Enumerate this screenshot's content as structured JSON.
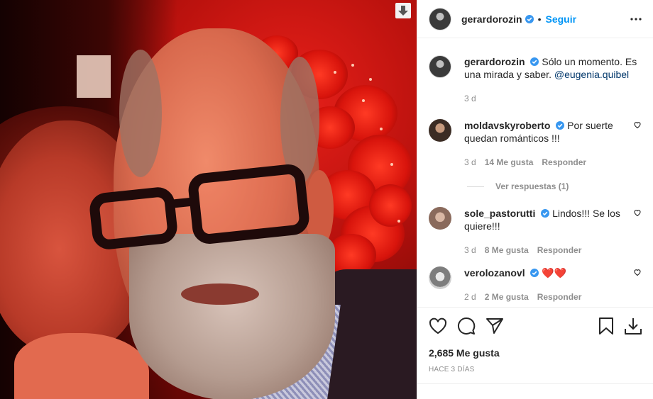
{
  "post": {
    "author": "gerardorozin",
    "follow_label": "Seguir",
    "separator": "•",
    "caption": {
      "author": "gerardorozin",
      "text": "Sólo un momento. Es una mirada y saber.",
      "mention": "@eugenia.quibel",
      "time": "3 d"
    },
    "comments": [
      {
        "user": "moldavskyroberto",
        "text": "Por suerte quedan románticos !!!",
        "time": "3 d",
        "likes": "14 Me gusta",
        "reply": "Responder",
        "avatar": "moldavsky"
      },
      {
        "user": "sole_pastorutti",
        "text": "Lindos!!! Se los quiere!!!",
        "time": "3 d",
        "likes": "8 Me gusta",
        "reply": "Responder",
        "avatar": "sole"
      },
      {
        "user": "verolozanovl",
        "text": "❤️❤️",
        "time": "2 d",
        "likes": "2 Me gusta",
        "reply": "Responder",
        "avatar": "vero"
      }
    ],
    "view_replies": "Ver respuestas (1)",
    "like_count": "2,685 Me gusta",
    "date_label": "HACE 3 DÍAS"
  },
  "icons": {
    "verified": "verified-badge-icon",
    "more": "more-options-icon",
    "like": "heart-icon",
    "comment": "comment-bubble-icon",
    "share": "paper-plane-icon",
    "save": "bookmark-icon",
    "download": "download-arrow-icon"
  },
  "colors": {
    "link_blue": "#0095f6",
    "verified": "#3897f0",
    "mention": "#00376b",
    "muted": "#8e8e8e"
  }
}
